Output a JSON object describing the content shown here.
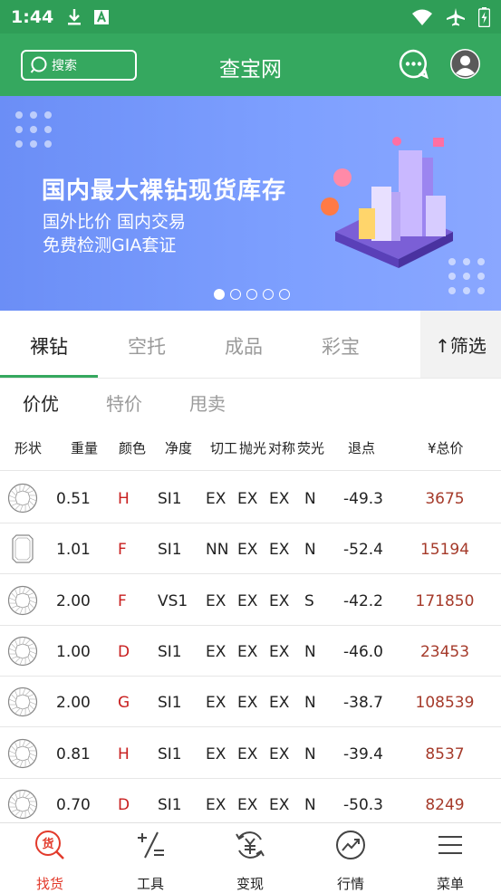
{
  "status_bar": {
    "time": "1:44"
  },
  "header": {
    "search_label": "搜索",
    "title": "查宝网"
  },
  "banner": {
    "headline": "国内最大裸钻现货库存",
    "line2": "国外比价 国内交易",
    "line3": "免费检测GIA套证",
    "page_count": 5,
    "active_page": 1
  },
  "category_tabs": [
    {
      "label": "裸钻",
      "active": true
    },
    {
      "label": "空托",
      "active": false
    },
    {
      "label": "成品",
      "active": false
    },
    {
      "label": "彩宝",
      "active": false
    }
  ],
  "filter_label": "↑筛选",
  "sub_tabs": [
    {
      "label": "价优",
      "active": true
    },
    {
      "label": "特价",
      "active": false
    },
    {
      "label": "甩卖",
      "active": false
    }
  ],
  "table": {
    "headers": [
      "形状",
      "重量",
      "颜色",
      "净度",
      "切工",
      "抛光",
      "对称",
      "荧光",
      "退点",
      "¥总价"
    ],
    "rows": [
      {
        "shape": "round",
        "weight": "0.51",
        "color": "H",
        "clarity": "SI1",
        "cut": "EX",
        "polish": "EX",
        "symmetry": "EX",
        "fluor": "N",
        "discount": "-49.3",
        "price": "3675"
      },
      {
        "shape": "emerald",
        "weight": "1.01",
        "color": "F",
        "clarity": "SI1",
        "cut": "NN",
        "polish": "EX",
        "symmetry": "EX",
        "fluor": "N",
        "discount": "-52.4",
        "price": "15194"
      },
      {
        "shape": "round",
        "weight": "2.00",
        "color": "F",
        "clarity": "VS1",
        "cut": "EX",
        "polish": "EX",
        "symmetry": "EX",
        "fluor": "S",
        "discount": "-42.2",
        "price": "171850"
      },
      {
        "shape": "round",
        "weight": "1.00",
        "color": "D",
        "clarity": "SI1",
        "cut": "EX",
        "polish": "EX",
        "symmetry": "EX",
        "fluor": "N",
        "discount": "-46.0",
        "price": "23453"
      },
      {
        "shape": "round",
        "weight": "2.00",
        "color": "G",
        "clarity": "SI1",
        "cut": "EX",
        "polish": "EX",
        "symmetry": "EX",
        "fluor": "N",
        "discount": "-38.7",
        "price": "108539"
      },
      {
        "shape": "round",
        "weight": "0.81",
        "color": "H",
        "clarity": "SI1",
        "cut": "EX",
        "polish": "EX",
        "symmetry": "EX",
        "fluor": "N",
        "discount": "-39.4",
        "price": "8537"
      },
      {
        "shape": "round",
        "weight": "0.70",
        "color": "D",
        "clarity": "SI1",
        "cut": "EX",
        "polish": "EX",
        "symmetry": "EX",
        "fluor": "N",
        "discount": "-50.3",
        "price": "8249"
      }
    ]
  },
  "bottom_nav": [
    {
      "label": "找货",
      "icon": "find-goods-icon",
      "active": true
    },
    {
      "label": "工具",
      "icon": "calculator-icon",
      "active": false
    },
    {
      "label": "变现",
      "icon": "cash-exchange-icon",
      "active": false
    },
    {
      "label": "行情",
      "icon": "trend-icon",
      "active": false
    },
    {
      "label": "菜单",
      "icon": "menu-icon",
      "active": false
    }
  ],
  "colors": {
    "brand_green": "#35a85f",
    "status_green": "#2f9e57",
    "banner_blue": "#7596fa",
    "accent_red": "#c81e1e",
    "price_red": "#a53a2a",
    "nav_active": "#e23a2b"
  }
}
